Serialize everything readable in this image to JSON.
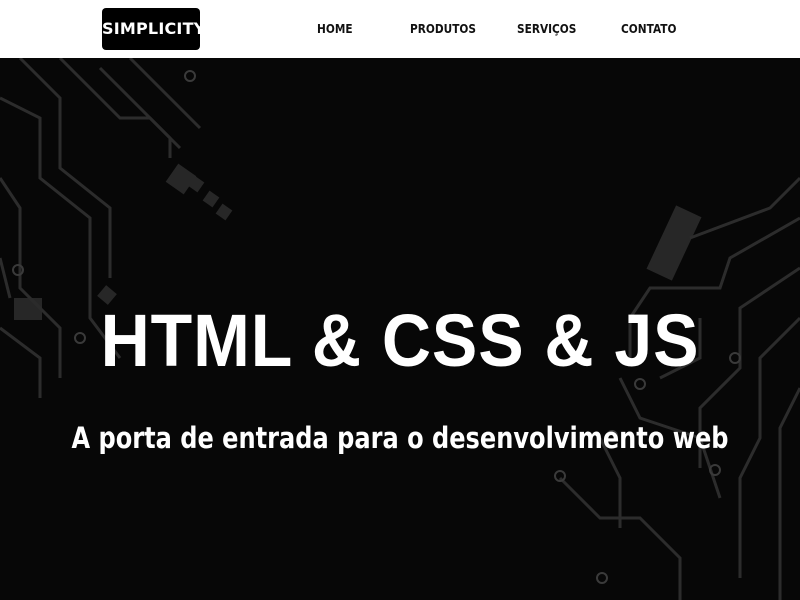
{
  "header": {
    "logo_text": "SIMPLICITY",
    "nav": [
      {
        "label": "HOME"
      },
      {
        "label": "PRODUTOS"
      },
      {
        "label": "SERVIÇOS"
      },
      {
        "label": "CONTATO"
      }
    ]
  },
  "hero": {
    "headline": "HTML & CSS & JS",
    "subtitle": "A porta de entrada para o desenvolvimento web",
    "background_color": "#070707",
    "circuit_color": "#3a3a3a"
  }
}
